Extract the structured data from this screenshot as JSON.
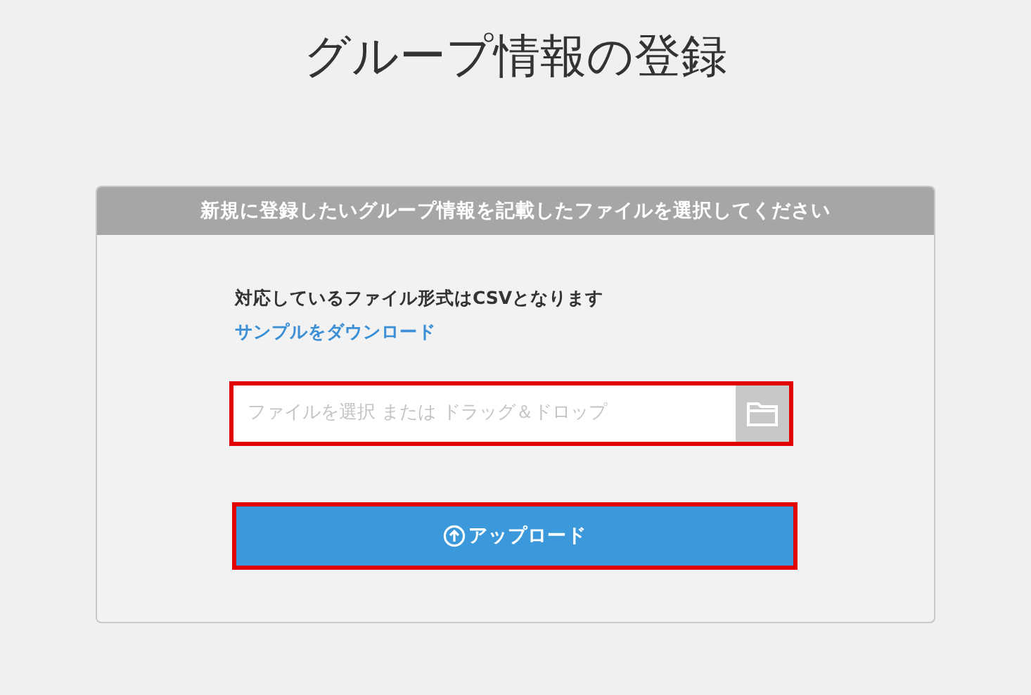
{
  "page_title": "グループ情報の登録",
  "card": {
    "header": "新規に登録したいグループ情報を記載したファイルを選択してください",
    "format_note": "対応しているファイル形式はCSVとなります",
    "sample_link": "サンプルをダウンロード",
    "file_field": {
      "placeholder": "ファイルを選択 または ドラッグ＆ドロップ",
      "highlighted": true
    },
    "upload_button": {
      "label": "アップロード",
      "highlighted": true
    }
  }
}
